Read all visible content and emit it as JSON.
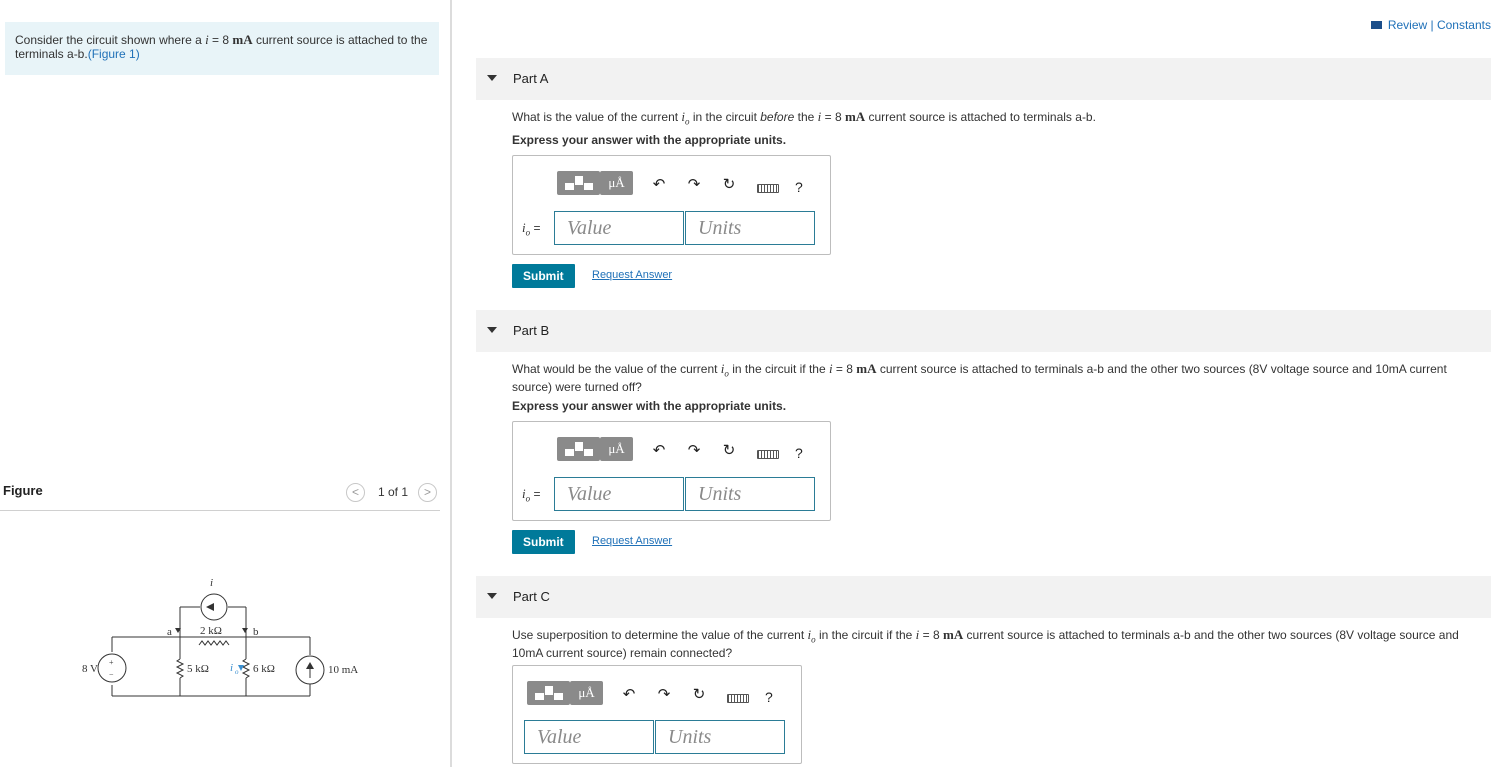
{
  "left": {
    "intro": {
      "prefix": "Consider the circuit shown where a ",
      "var_i": "i",
      "eq": " = 8 ",
      "unit": "mA",
      "suffix": " current source is attached to the terminals a-b.",
      "figure_link": "(Figure 1)"
    },
    "figure": {
      "title": "Figure",
      "prev": "<",
      "next": ">",
      "pager": "1 of 1"
    },
    "circuit": {
      "label_i": "i",
      "label_a": "a",
      "label_b": "b",
      "r1": "2 kΩ",
      "r2": "5 kΩ",
      "r3": "6 kΩ",
      "v_source": "8 V",
      "i_source": "10 mA",
      "label_io": "i",
      "label_io_sub": "o",
      "plus": "+",
      "minus": "−"
    }
  },
  "header": {
    "review": "Review | Constants"
  },
  "toolbar": {
    "unit_glyph": "μÅ",
    "undo": "↶",
    "redo": "↷",
    "reset": "↻",
    "help": "?"
  },
  "parts": [
    {
      "label": "Part A",
      "question_a": "What is the value of the current ",
      "var_io": "i",
      "var_io_sub": "o",
      "question_b": " in the circuit ",
      "question_em": "before",
      "question_c": " the ",
      "var_i": "i",
      "question_d": " = 8 ",
      "unit": "mA",
      "question_e": " current source is attached to terminals a-b.",
      "instruction": "Express your answer with the appropriate units.",
      "var_label": "i",
      "var_label_sub": "o",
      "eq_sign": " =",
      "value_placeholder": "Value",
      "units_placeholder": "Units",
      "submit": "Submit",
      "request": "Request Answer"
    },
    {
      "label": "Part B",
      "question_a": "What would be the value of the current ",
      "var_io": "i",
      "var_io_sub": "o",
      "question_b": " in the circuit if the ",
      "var_i": "i",
      "question_c": " = 8 ",
      "unit": "mA",
      "question_d": " current source is attached to terminals a-b and the other two sources (8V voltage source and 10mA current source) were turned off?",
      "instruction": "Express your answer with the appropriate units.",
      "var_label": "i",
      "var_label_sub": "o",
      "eq_sign": " =",
      "value_placeholder": "Value",
      "units_placeholder": "Units",
      "submit": "Submit",
      "request": "Request Answer"
    },
    {
      "label": "Part C",
      "question_a": "Use superposition to determine the value of the current ",
      "var_io": "i",
      "var_io_sub": "o",
      "question_b": " in the circuit if the ",
      "var_i": "i",
      "question_c": " = 8 ",
      "unit": "mA",
      "question_d": " current source is attached to terminals a-b and the other two sources (8V voltage source and 10mA current source) remain connected?",
      "value_placeholder": "Value",
      "units_placeholder": "Units"
    }
  ]
}
